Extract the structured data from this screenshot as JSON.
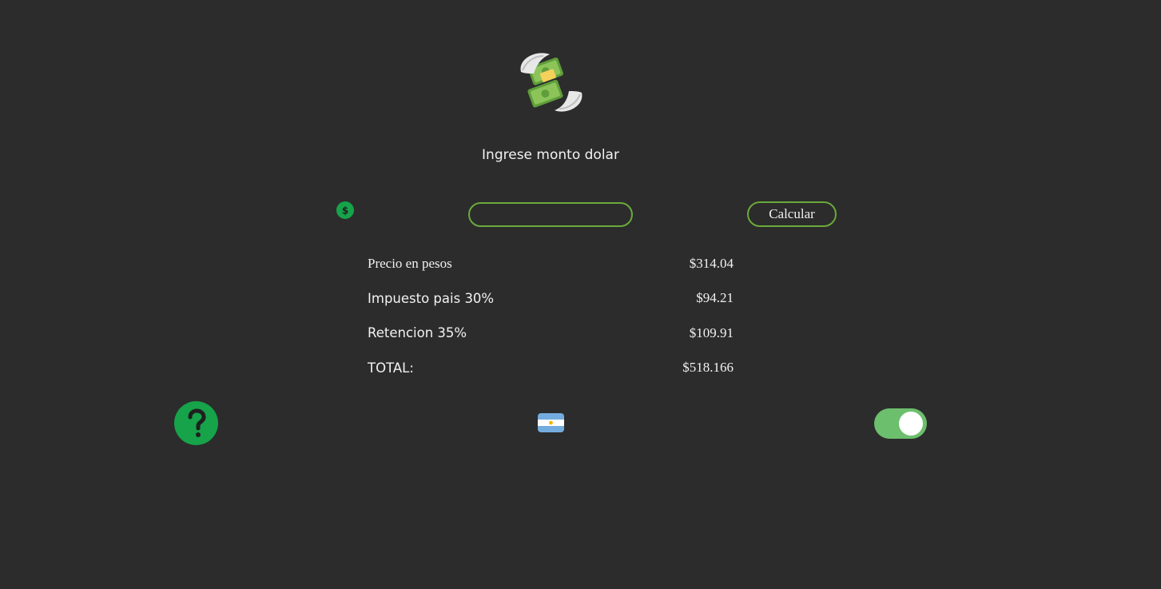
{
  "header": {
    "logo_icon": "money-with-wings-icon",
    "prompt": "Ingrese monto dolar"
  },
  "input": {
    "currency_icon": "dollar-circle-icon",
    "value": "",
    "placeholder": ""
  },
  "actions": {
    "calculate_label": "Calcular"
  },
  "results": [
    {
      "label": "Precio en pesos",
      "value": "$314.04"
    },
    {
      "label": "Impuesto pais 30%",
      "value": "$94.21"
    },
    {
      "label": "Retencion 35%",
      "value": "$109.91"
    },
    {
      "label": "TOTAL:",
      "value": "$518.166"
    }
  ],
  "footer": {
    "help_icon": "question-mark-icon",
    "flag_icon": "argentina-flag-icon",
    "toggle_state": "on"
  },
  "colors": {
    "background": "#2c2c2c",
    "accent_green": "#16a34a",
    "border_green": "#6aaa3a",
    "toggle_green": "#6cbf6c",
    "text": "#f2f2f2"
  }
}
